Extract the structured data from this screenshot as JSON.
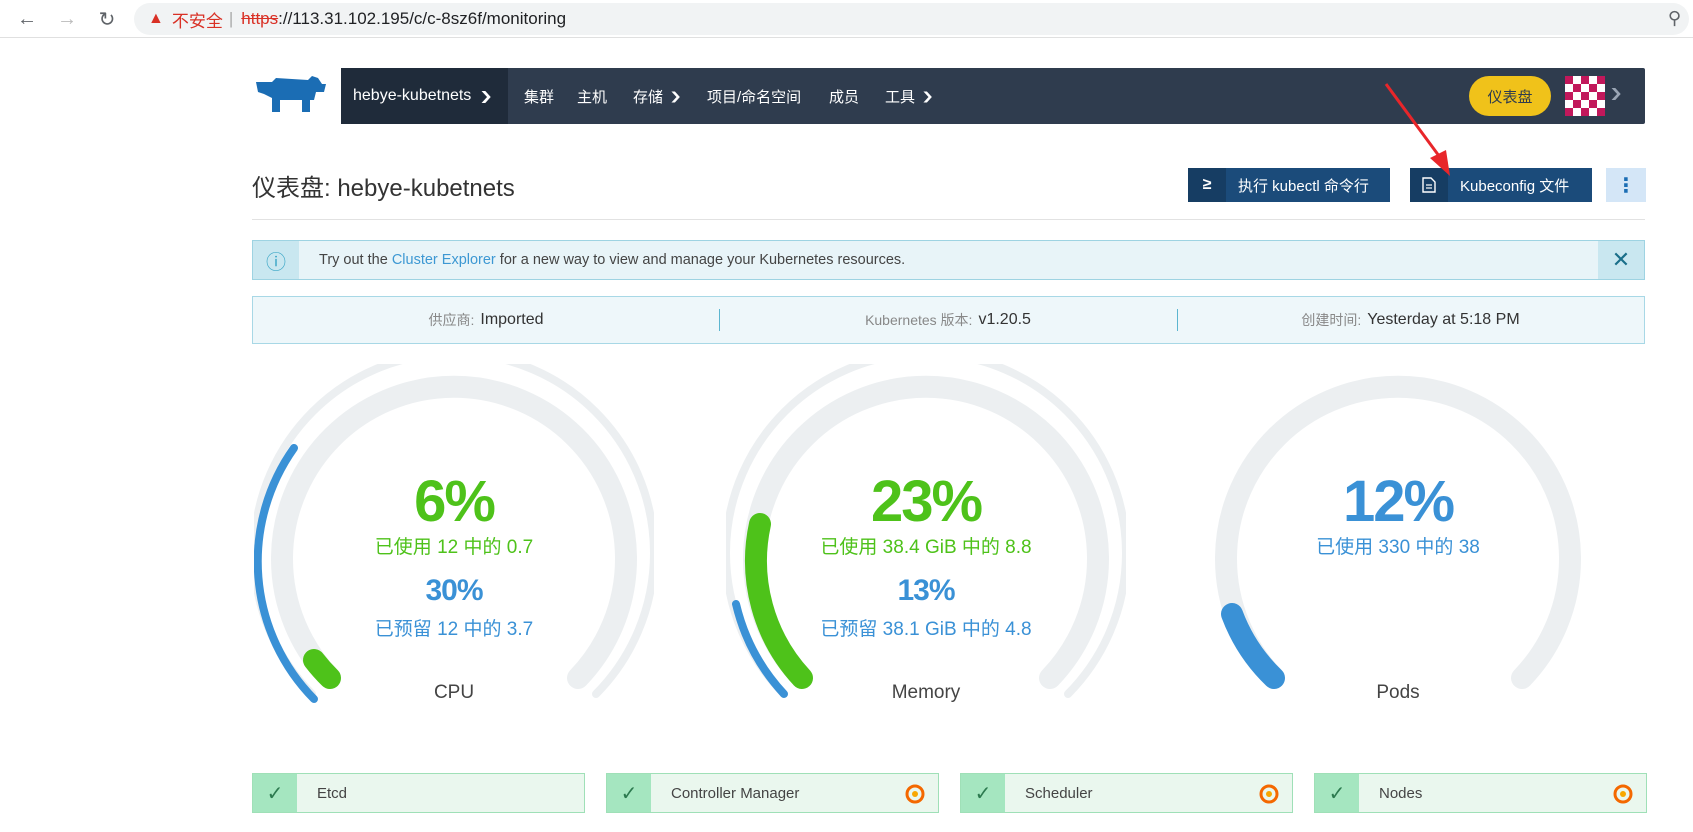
{
  "browser": {
    "warning_text": "不安全",
    "separator": "|",
    "url_scheme": "https",
    "url_rest": "://113.31.102.195/c/c-8sz6f/monitoring"
  },
  "nav": {
    "cluster": "hebye-kubetnets",
    "items": [
      "集群",
      "主机",
      "存储",
      "项目/命名空间",
      "成员",
      "工具"
    ],
    "dashboard_pill": "仪表盘"
  },
  "page": {
    "title": "仪表盘: hebye-kubetnets",
    "kubectl_button": "执行 kubectl 命令行",
    "kubeconfig_button": "Kubeconfig 文件",
    "kubectl_icon_glyph": "≥",
    "more_glyph": "⋮"
  },
  "banner": {
    "prefix": "Try out the ",
    "link": "Cluster Explorer",
    "suffix": " for a new way to view and manage your Kubernetes resources."
  },
  "meta": {
    "provider_key": "供应商:",
    "provider_value": "Imported",
    "version_key": "Kubernetes 版本:",
    "version_value": "v1.20.5",
    "created_key": "创建时间:",
    "created_value": "Yesterday at 5:18 PM"
  },
  "gauges": {
    "cpu": {
      "name": "CPU",
      "used_pct": "6%",
      "used_text": "已使用 12 中的 0.7",
      "reserved_pct": "30%",
      "reserved_text": "已预留 12 中的 3.7"
    },
    "memory": {
      "name": "Memory",
      "used_pct": "23%",
      "used_text": "已使用 38.4 GiB 中的 8.8",
      "reserved_pct": "13%",
      "reserved_text": "已预留 38.1 GiB 中的 4.8"
    },
    "pods": {
      "name": "Pods",
      "used_pct": "12%",
      "used_text": "已使用 330 中的 38"
    }
  },
  "status": [
    {
      "label": "Etcd",
      "grafana": false
    },
    {
      "label": "Controller Manager",
      "grafana": true
    },
    {
      "label": "Scheduler",
      "grafana": true
    },
    {
      "label": "Nodes",
      "grafana": true
    }
  ],
  "colors": {
    "nav_bg": "#2f3c4e",
    "accent_yellow": "#f0c21a",
    "button_blue": "#1b4b7a",
    "gauge_green": "#4ec21a",
    "gauge_blue": "#3a91d6",
    "status_green": "#a5e6c0"
  }
}
